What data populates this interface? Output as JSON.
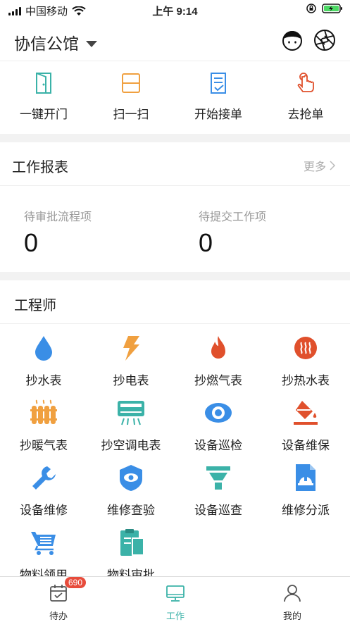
{
  "status_bar": {
    "carrier": "中国移动",
    "time": "上午 9:14"
  },
  "header": {
    "title": "协信公馆"
  },
  "quick_actions": [
    {
      "label": "一键开门",
      "icon": "door-icon"
    },
    {
      "label": "扫一扫",
      "icon": "scan-icon"
    },
    {
      "label": "开始接单",
      "icon": "order-list-icon"
    },
    {
      "label": "去抢单",
      "icon": "hand-tap-icon"
    }
  ],
  "report": {
    "title": "工作报表",
    "more": "更多",
    "pending_approval": {
      "label": "待审批流程项",
      "value": "0"
    },
    "pending_submit": {
      "label": "待提交工作项",
      "value": "0"
    }
  },
  "engineer": {
    "title": "工程师",
    "items": [
      {
        "label": "抄水表",
        "icon": "water-drop-icon"
      },
      {
        "label": "抄电表",
        "icon": "lightning-icon"
      },
      {
        "label": "抄燃气表",
        "icon": "flame-icon"
      },
      {
        "label": "抄热水表",
        "icon": "hot-water-icon"
      },
      {
        "label": "抄暖气表",
        "icon": "radiator-icon"
      },
      {
        "label": "抄空调电表",
        "icon": "air-conditioner-icon"
      },
      {
        "label": "设备巡检",
        "icon": "eye-icon"
      },
      {
        "label": "设备维保",
        "icon": "paint-bucket-icon"
      },
      {
        "label": "设备维修",
        "icon": "wrench-icon"
      },
      {
        "label": "维修查验",
        "icon": "shield-eye-icon"
      },
      {
        "label": "设备巡查",
        "icon": "funnel-icon"
      },
      {
        "label": "维修分派",
        "icon": "worker-document-icon"
      },
      {
        "label": "物料领用",
        "icon": "cart-icon"
      },
      {
        "label": "物料审批",
        "icon": "clipboard-icon"
      }
    ]
  },
  "tabs": [
    {
      "label": "待办",
      "badge": "690",
      "icon": "calendar-check-icon"
    },
    {
      "label": "工作",
      "icon": "monitor-icon",
      "active": true
    },
    {
      "label": "我的",
      "icon": "person-icon"
    }
  ],
  "colors": {
    "teal": "#3bb2a8",
    "orange": "#f0a040",
    "blue": "#3a8ee6",
    "red": "#e0502c"
  }
}
